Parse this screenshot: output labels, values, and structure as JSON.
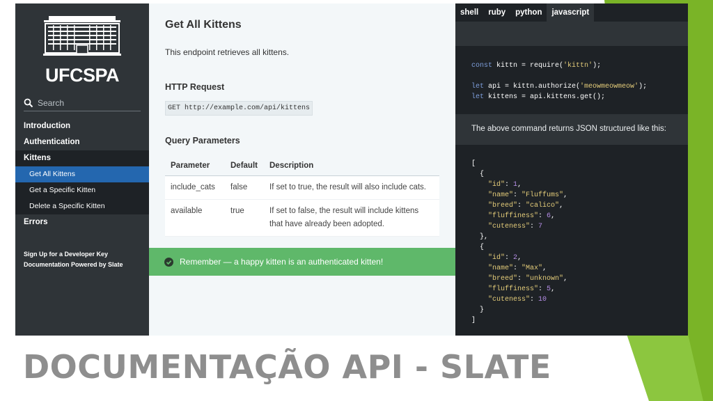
{
  "colors": {
    "accent_green": "#7ab427",
    "sidebar_bg": "#2f3438",
    "nav_active": "#2467af",
    "notice_green": "#5fb86a",
    "title_gray": "#8e8e8e"
  },
  "logo": {
    "text": "UFCSPA"
  },
  "search": {
    "placeholder": "Search",
    "icon": "search-icon"
  },
  "nav": {
    "introduction": "Introduction",
    "authentication": "Authentication",
    "kittens": "Kittens",
    "get_all": "Get All Kittens",
    "get_specific": "Get a Specific Kitten",
    "delete_specific": "Delete a Specific Kitten",
    "errors": "Errors"
  },
  "footer_links": {
    "signup": "Sign Up for a Developer Key",
    "powered": "Documentation Powered by Slate"
  },
  "main": {
    "title": "Get All Kittens",
    "intro": "This endpoint retrieves all kittens.",
    "http_request_heading": "HTTP Request",
    "http_request": "GET http://example.com/api/kittens",
    "query_heading": "Query Parameters",
    "table": {
      "headers": [
        "Parameter",
        "Default",
        "Description"
      ],
      "rows": [
        [
          "include_cats",
          "false",
          "If set to true, the result will also include cats."
        ],
        [
          "available",
          "true",
          "If set to false, the result will include kittens that have already been adopted."
        ]
      ]
    },
    "notice": "Remember — a happy kitten is an authenticated kitten!"
  },
  "code": {
    "tabs": [
      "shell",
      "ruby",
      "python",
      "javascript"
    ],
    "active_tab": "javascript",
    "returns_text": "The above command returns JSON structured like this:"
  },
  "slide_title": "DOCUMENTAÇÃO API - SLATE"
}
